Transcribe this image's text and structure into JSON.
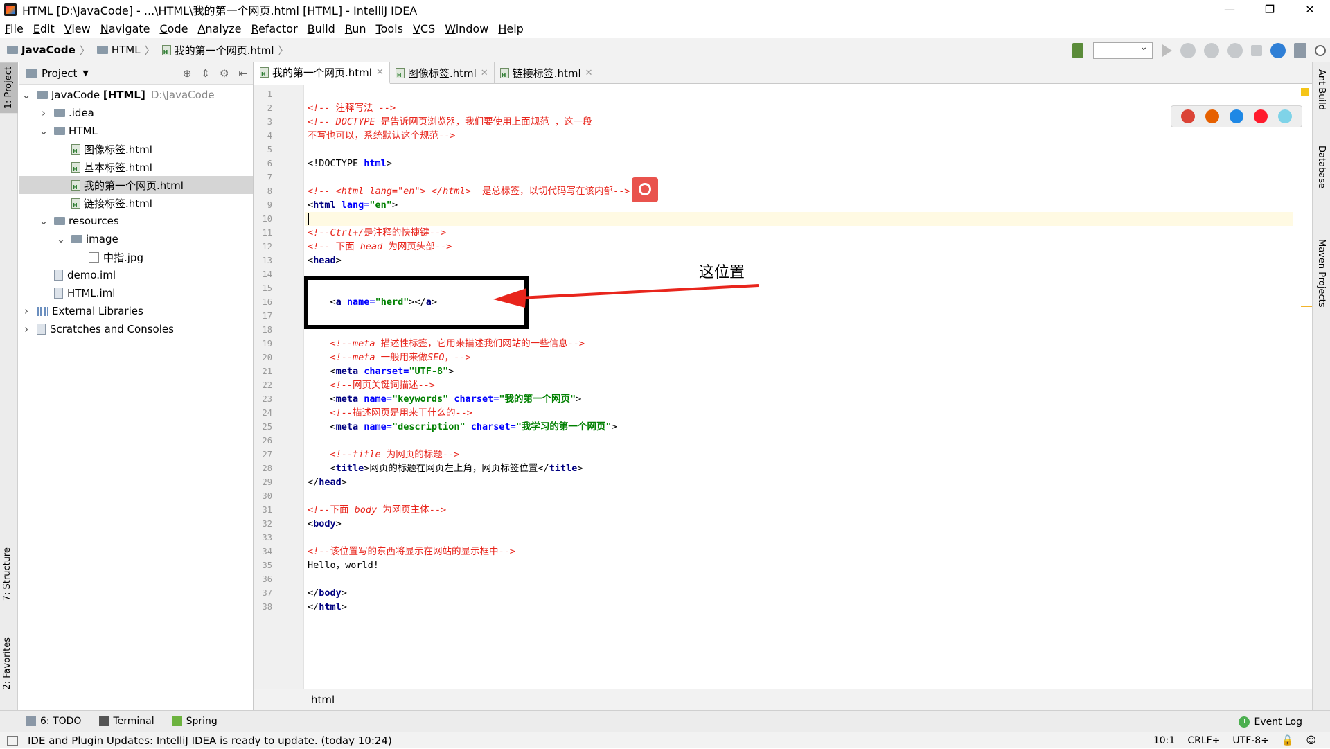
{
  "window": {
    "title": "HTML [D:\\JavaCode] - ...\\HTML\\我的第一个网页.html [HTML] - IntelliJ IDEA",
    "controls": {
      "minimize": "—",
      "restore": "❐",
      "close": "✕"
    }
  },
  "menu": [
    "File",
    "Edit",
    "View",
    "Navigate",
    "Code",
    "Analyze",
    "Refactor",
    "Build",
    "Run",
    "Tools",
    "VCS",
    "Window",
    "Help"
  ],
  "breadcrumb": [
    {
      "label": "JavaCode",
      "icon": "project-folder-icon"
    },
    {
      "label": "HTML",
      "icon": "folder-icon"
    },
    {
      "label": "我的第一个网页.html",
      "icon": "html-file-icon"
    }
  ],
  "left_strip": {
    "project_tab": "1: Project",
    "structure_tab": "7: Structure",
    "favorites_tab": "2: Favorites"
  },
  "right_strip": {
    "ant": "Ant Build",
    "database": "Database",
    "maven": "Maven Projects"
  },
  "project_panel": {
    "title": "Project",
    "tree": [
      {
        "label": "JavaCode [HTML]",
        "detail": "D:\\JavaCode",
        "depth": 0,
        "expanded": true,
        "type": "project"
      },
      {
        "label": ".idea",
        "depth": 1,
        "expanded": false,
        "type": "folder"
      },
      {
        "label": "HTML",
        "depth": 1,
        "expanded": true,
        "type": "folder"
      },
      {
        "label": "图像标签.html",
        "depth": 2,
        "type": "html"
      },
      {
        "label": "基本标签.html",
        "depth": 2,
        "type": "html"
      },
      {
        "label": "我的第一个网页.html",
        "depth": 2,
        "type": "html",
        "selected": true
      },
      {
        "label": "链接标签.html",
        "depth": 2,
        "type": "html"
      },
      {
        "label": "resources",
        "depth": 1,
        "expanded": true,
        "type": "folder"
      },
      {
        "label": "image",
        "depth": 2,
        "expanded": true,
        "type": "folder"
      },
      {
        "label": "中指.jpg",
        "depth": 3,
        "type": "jpg"
      },
      {
        "label": "demo.iml",
        "depth": 1,
        "type": "iml"
      },
      {
        "label": "HTML.iml",
        "depth": 1,
        "type": "iml"
      },
      {
        "label": "External Libraries",
        "depth": 0,
        "expanded": false,
        "type": "lib"
      },
      {
        "label": "Scratches and Consoles",
        "depth": 0,
        "expanded": false,
        "type": "scratch"
      }
    ]
  },
  "editor_tabs": [
    {
      "label": "我的第一个网页.html",
      "active": true
    },
    {
      "label": "图像标签.html",
      "active": false
    },
    {
      "label": "链接标签.html",
      "active": false
    }
  ],
  "code_lines": [
    {
      "n": "1",
      "html": ""
    },
    {
      "n": "2",
      "html": "<span class='cmi'>&lt;!-- </span><span class='cm'>注释写法 </span><span class='cmi'>--&gt;</span>"
    },
    {
      "n": "3",
      "html": "<span class='cmi'>&lt;!-- DOCTYPE </span><span class='cm'>是告诉网页浏览器，我们要使用上面规范 ，这一段</span>"
    },
    {
      "n": "4",
      "html": "<span class='cm'>不写也可以，系统默认这个规范--&gt;</span>"
    },
    {
      "n": "5",
      "html": ""
    },
    {
      "n": "6",
      "html": "<span class='tx'>&lt;!DOCTYPE </span><span class='at'>html</span><span class='tx'>&gt;</span>"
    },
    {
      "n": "7",
      "html": ""
    },
    {
      "n": "8",
      "html": "<span class='cmi'>&lt;!-- &lt;html lang=\"en\"&gt; &lt;/html&gt;  </span><span class='cm'>是总标签，以切代码写在该内部--&gt;</span>"
    },
    {
      "n": "9",
      "html": "<span class='tx'>&lt;</span><span class='tg'>html </span><span class='at'>lang=</span><span class='av'>\"en\"</span><span class='tx'>&gt;</span>"
    },
    {
      "n": "10",
      "html": "<span class='cursor'></span>",
      "current": true
    },
    {
      "n": "11",
      "html": "<span class='cmi'>&lt;!--Ctrl+/</span><span class='cm'>是注释的快捷键--&gt;</span>"
    },
    {
      "n": "12",
      "html": "<span class='cmi'>&lt;!-- </span><span class='cm'>下面 </span><span class='cmi'>head </span><span class='cm'>为网页头部--&gt;</span>"
    },
    {
      "n": "13",
      "html": "<span class='tx'>&lt;</span><span class='tg'>head</span><span class='tx'>&gt;</span>"
    },
    {
      "n": "14",
      "html": ""
    },
    {
      "n": "15",
      "html": ""
    },
    {
      "n": "16",
      "html": "    <span class='tx'>&lt;</span><span class='tg'>a </span><span class='at'>name=</span><span class='av'>\"herd\"</span><span class='tx'>&gt;&lt;/</span><span class='tg'>a</span><span class='tx'>&gt;</span>"
    },
    {
      "n": "17",
      "html": ""
    },
    {
      "n": "18",
      "html": ""
    },
    {
      "n": "19",
      "html": "    <span class='cmi'>&lt;!--meta </span><span class='cm'>描述性标签，它用来描述我们网站的一些信息--&gt;</span>"
    },
    {
      "n": "20",
      "html": "    <span class='cmi'>&lt;!--meta </span><span class='cm'>一般用来做</span><span class='cmi'>SEO</span><span class='cm'>，--&gt;</span>"
    },
    {
      "n": "21",
      "html": "    <span class='tx'>&lt;</span><span class='tg'>meta </span><span class='at'>charset=</span><span class='av'>\"UTF-8\"</span><span class='tx'>&gt;</span>"
    },
    {
      "n": "22",
      "html": "    <span class='cmi'>&lt;!--</span><span class='cm'>网页关键词描述--&gt;</span>"
    },
    {
      "n": "23",
      "html": "    <span class='tx'>&lt;</span><span class='tg'>meta </span><span class='at'>name=</span><span class='av'>\"keywords\" </span><span class='at'>charset=</span><span class='av'>\"我的第一个网页\"</span><span class='tx'>&gt;</span>"
    },
    {
      "n": "24",
      "html": "    <span class='cmi'>&lt;!--</span><span class='cm'>描述网页是用来干什么的--&gt;</span>"
    },
    {
      "n": "25",
      "html": "    <span class='tx'>&lt;</span><span class='tg'>meta </span><span class='at'>name=</span><span class='av'>\"description\" </span><span class='at'>charset=</span><span class='av'>\"我学习的第一个网页\"</span><span class='tx'>&gt;</span>"
    },
    {
      "n": "26",
      "html": ""
    },
    {
      "n": "27",
      "html": "    <span class='cmi'>&lt;!--title </span><span class='cm'>为网页的标题--&gt;</span>"
    },
    {
      "n": "28",
      "html": "    <span class='tx'>&lt;</span><span class='tg'>title</span><span class='tx'>&gt;网页的标题在网页左上角，网页标签位置&lt;/</span><span class='tg'>title</span><span class='tx'>&gt;</span>"
    },
    {
      "n": "29",
      "html": "<span class='tx'>&lt;/</span><span class='tg'>head</span><span class='tx'>&gt;</span>"
    },
    {
      "n": "30",
      "html": ""
    },
    {
      "n": "31",
      "html": "<span class='cmi'>&lt;!--</span><span class='cm'>下面 </span><span class='cmi'>body </span><span class='cm'>为网页主体--&gt;</span>"
    },
    {
      "n": "32",
      "html": "<span class='tx'>&lt;</span><span class='tg'>body</span><span class='tx'>&gt;</span>"
    },
    {
      "n": "33",
      "html": ""
    },
    {
      "n": "34",
      "html": "<span class='cmi'>&lt;!--</span><span class='cm'>该位置写的东西将显示在网站的显示框中--&gt;</span>"
    },
    {
      "n": "35",
      "html": "<span class='tx'>Hello，world!</span>"
    },
    {
      "n": "36",
      "html": ""
    },
    {
      "n": "37",
      "html": "<span class='tx'>&lt;/</span><span class='tg'>body</span><span class='tx'>&gt;</span>"
    },
    {
      "n": "38",
      "html": "<span class='tx'>&lt;/</span><span class='tg'>html</span><span class='tx'>&gt;</span>"
    }
  ],
  "annotation": {
    "label": "这位置"
  },
  "browser_icons": [
    {
      "name": "chrome-icon",
      "color": "#db4437"
    },
    {
      "name": "firefox-icon",
      "color": "#e66000"
    },
    {
      "name": "safari-icon",
      "color": "#1e88e5"
    },
    {
      "name": "opera-icon",
      "color": "#ff1b2d"
    },
    {
      "name": "edge-icon",
      "color": "#7fd3e8"
    }
  ],
  "editor_footer": {
    "breadcrumb": "html"
  },
  "bottom_bar": [
    {
      "label": "6: TODO",
      "icon": "todo-icon"
    },
    {
      "label": "Terminal",
      "icon": "terminal-icon"
    },
    {
      "label": "Spring",
      "icon": "spring-icon"
    }
  ],
  "event_log": {
    "label": "Event Log",
    "count": "1"
  },
  "status": {
    "message": "IDE and Plugin Updates: IntelliJ IDEA is ready to update. (today 10:24)",
    "position": "10:1",
    "line_sep": "CRLF÷",
    "encoding": "UTF-8÷"
  }
}
